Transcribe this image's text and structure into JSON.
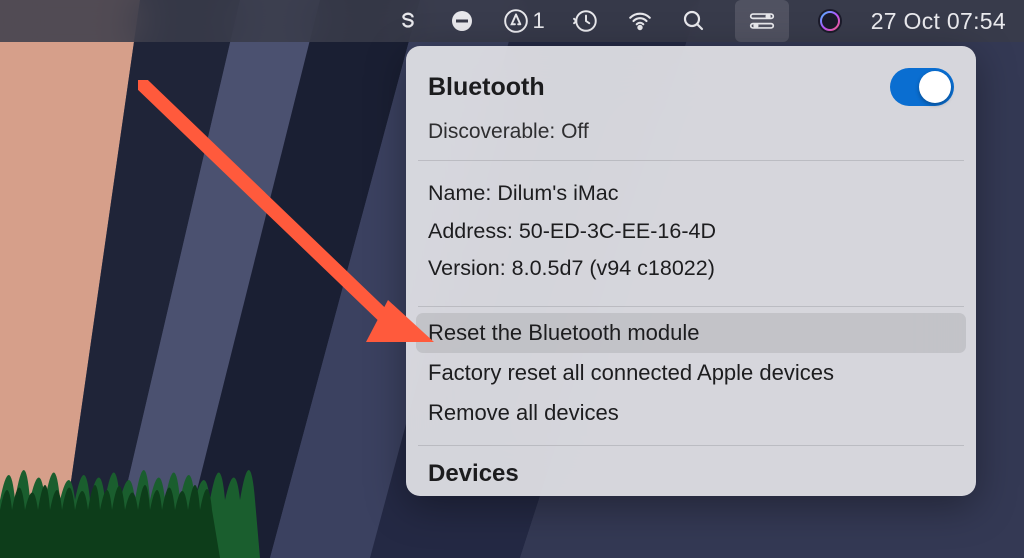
{
  "menubar": {
    "badge_count": "1",
    "datetime": "27 Oct  07:54"
  },
  "bluetooth_panel": {
    "title": "Bluetooth",
    "toggle_on": true,
    "discoverable_label": "Discoverable:",
    "discoverable_value": "Off",
    "name_label": "Name:",
    "name_value": "Dilum's iMac",
    "address_label": "Address:",
    "address_value": "50-ED-3C-EE-16-4D",
    "version_label": "Version:",
    "version_value": "8.0.5d7 (v94 c18022)",
    "actions": {
      "reset_module": "Reset the Bluetooth module",
      "factory_reset": "Factory reset all connected Apple devices",
      "remove_all": "Remove all devices"
    },
    "devices_header": "Devices"
  }
}
